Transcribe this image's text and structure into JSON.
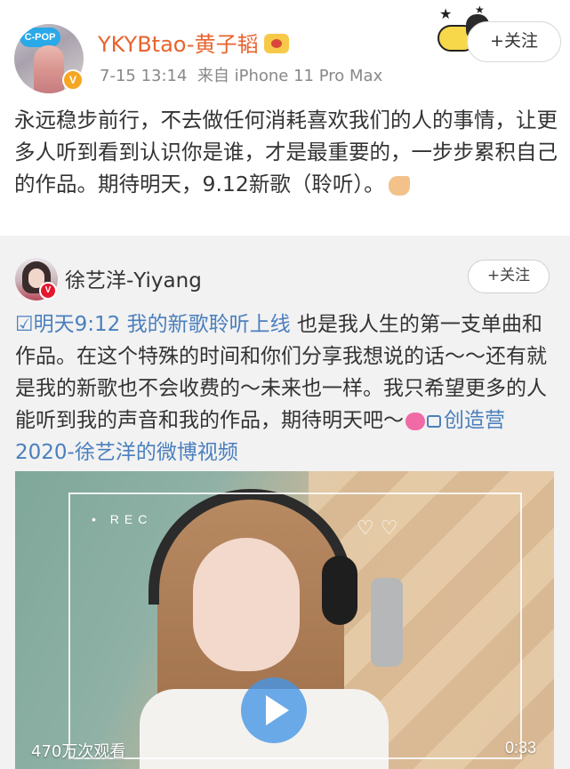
{
  "post": {
    "username": "YKYBtao-黄子韬",
    "time": "7-15 13:14",
    "source": "来自 iPhone 11 Pro Max",
    "follow_label": "+关注",
    "text": "永远稳步前行，不去做任何消耗喜欢我们的人的事情，让更多人听到看到认识你是谁，才是最重要的，一步步累积自己的作品。期待明天，9.12新歌（聆听）。",
    "avatar_logo_text": "C-POP"
  },
  "repost": {
    "username": "徐艺洋-Yiyang",
    "follow_label": "+关注",
    "link_text": "明天9:12 我的新歌聆听上线",
    "text": " 也是我人生的第一支单曲和作品。在这个特殊的时间和你们分享我想说的话～～还有就是我的新歌也不会收费的～未来也一样。我只希望更多的人能听到我的声音和我的作品，期待明天吧～",
    "video_link_text": "创造营2020-徐艺洋的微博视频"
  },
  "video": {
    "rec_label": "REC",
    "views": "470万次观看",
    "duration": "0:33"
  },
  "icons": {
    "verified": "verified-badge-icon",
    "crown": "member-crown-icon",
    "emoji_muscle": "muscle-emoji-icon",
    "emoji_heart": "heart-gift-emoji-icon",
    "video": "video-camera-icon",
    "play": "play-icon"
  },
  "colors": {
    "username": "#e8632d",
    "link": "#4a7fbd",
    "repost_bg": "#f2f2f2",
    "verified": "#f5a623",
    "verified_rt": "#e6162d"
  }
}
